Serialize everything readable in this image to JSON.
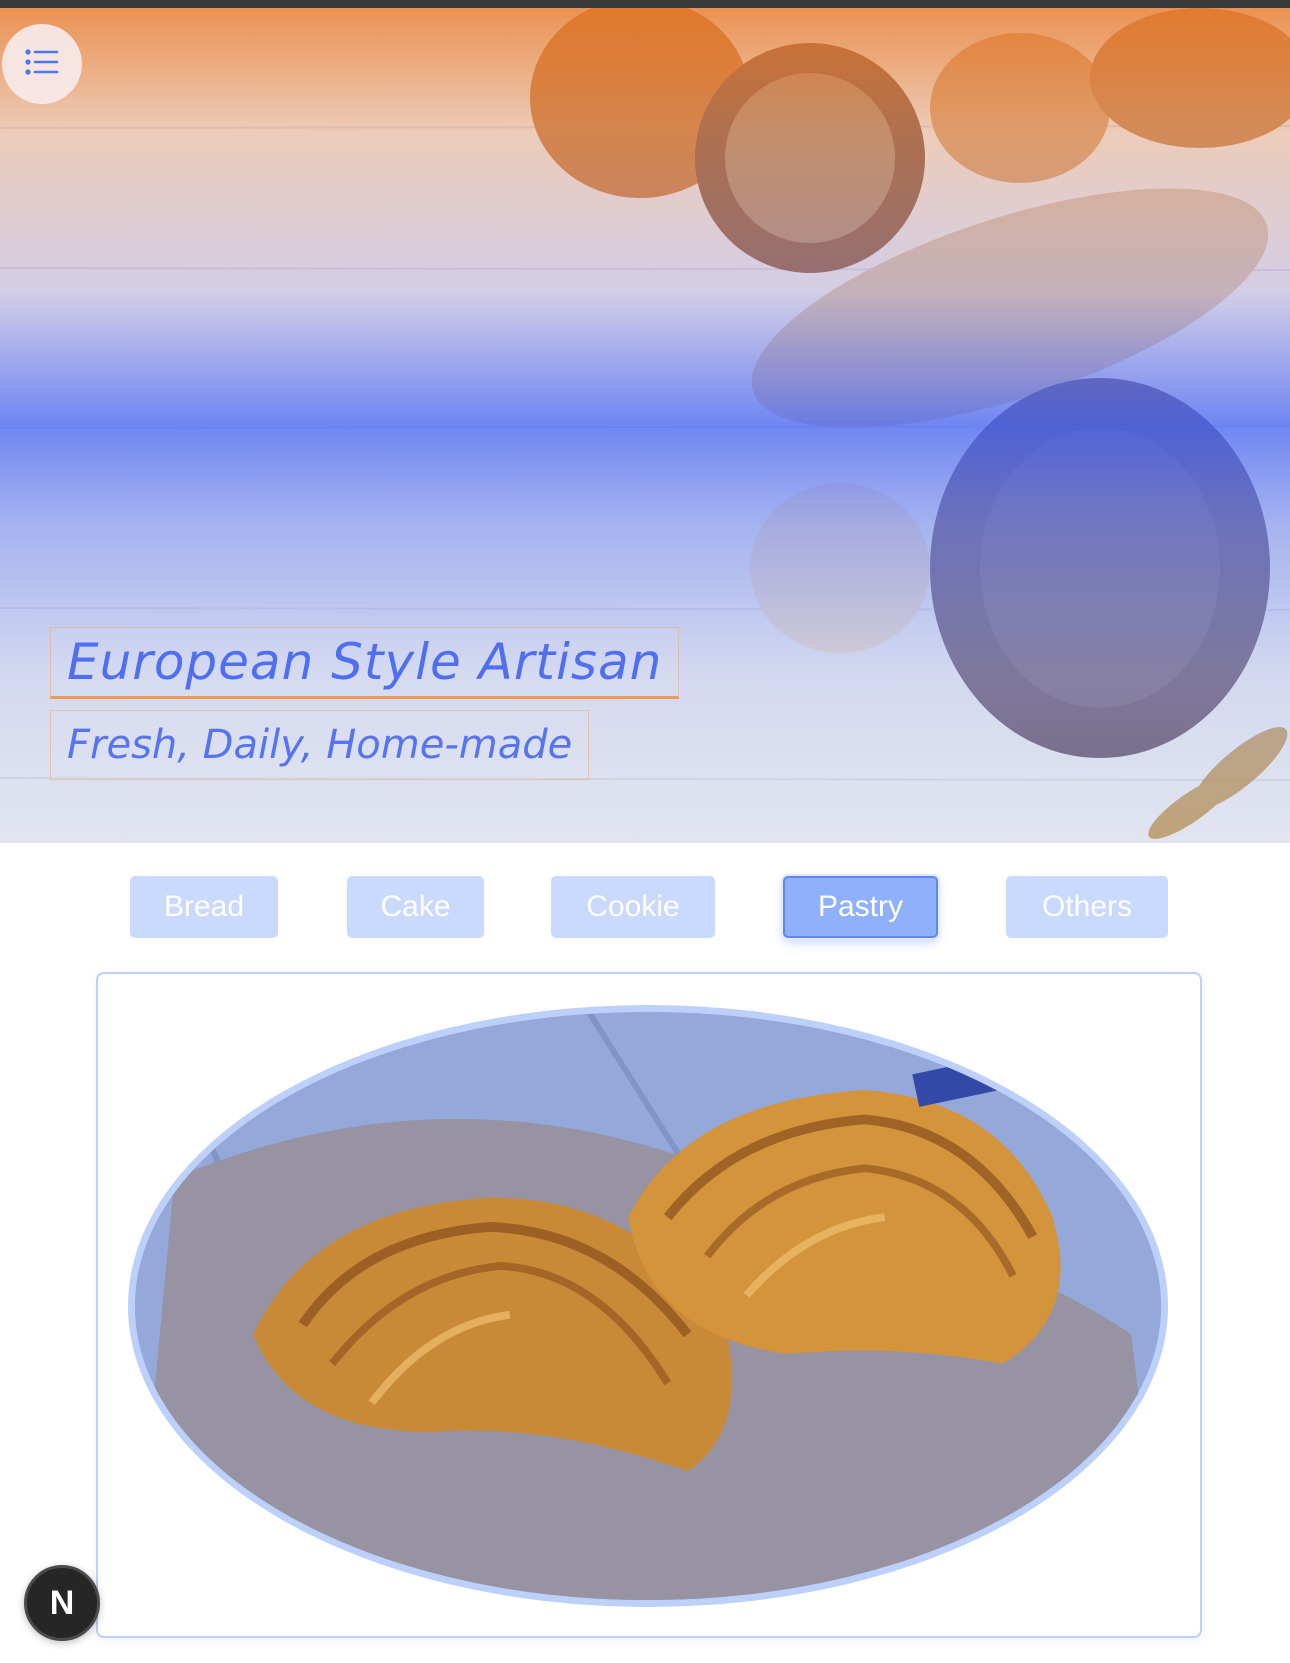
{
  "hero": {
    "title": "European Style Artisan",
    "subtitle": "Fresh, Daily, Home-made"
  },
  "menu_button": {
    "icon": "list-icon"
  },
  "tabs": [
    {
      "label": "Bread",
      "active": false
    },
    {
      "label": "Cake",
      "active": false
    },
    {
      "label": "Cookie",
      "active": false
    },
    {
      "label": "Pastry",
      "active": true
    },
    {
      "label": "Others",
      "active": false
    }
  ],
  "product_image": {
    "subject": "croissants"
  },
  "badge": {
    "label": "N"
  },
  "colors": {
    "accent_blue": "#5674ef",
    "tab_inactive": "#c9dafe",
    "tab_active": "#8fb0fb",
    "hero_orange": "#e8782a"
  }
}
